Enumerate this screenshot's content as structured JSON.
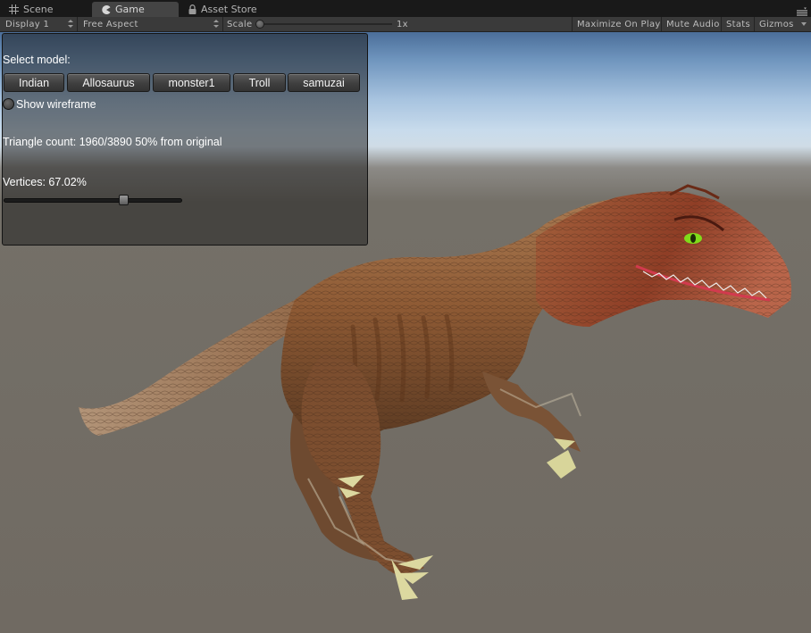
{
  "tabs": [
    {
      "label": "Scene",
      "icon": "grid-icon",
      "active": false
    },
    {
      "label": "Game",
      "icon": "pacman-icon",
      "active": true
    },
    {
      "label": "Asset Store",
      "icon": "lock-icon",
      "active": false
    }
  ],
  "toolbar": {
    "display": "Display 1",
    "aspect": "Free Aspect",
    "scale_label": "Scale",
    "scale_value": "1x",
    "maximize": "Maximize On Play",
    "mute": "Mute Audio",
    "stats": "Stats",
    "gizmos": "Gizmos"
  },
  "panel": {
    "select_label": "Select model:",
    "models": [
      "Indian",
      "Allosaurus",
      "monster1",
      "Troll",
      "samuzai"
    ],
    "wireframe_label": "Show wireframe",
    "wireframe_on": false,
    "triangle_text": "Triangle count: 1960/3890 50% from original",
    "vertices_text": "Vertices: 67.02%",
    "vertices_fraction": 0.6702
  }
}
